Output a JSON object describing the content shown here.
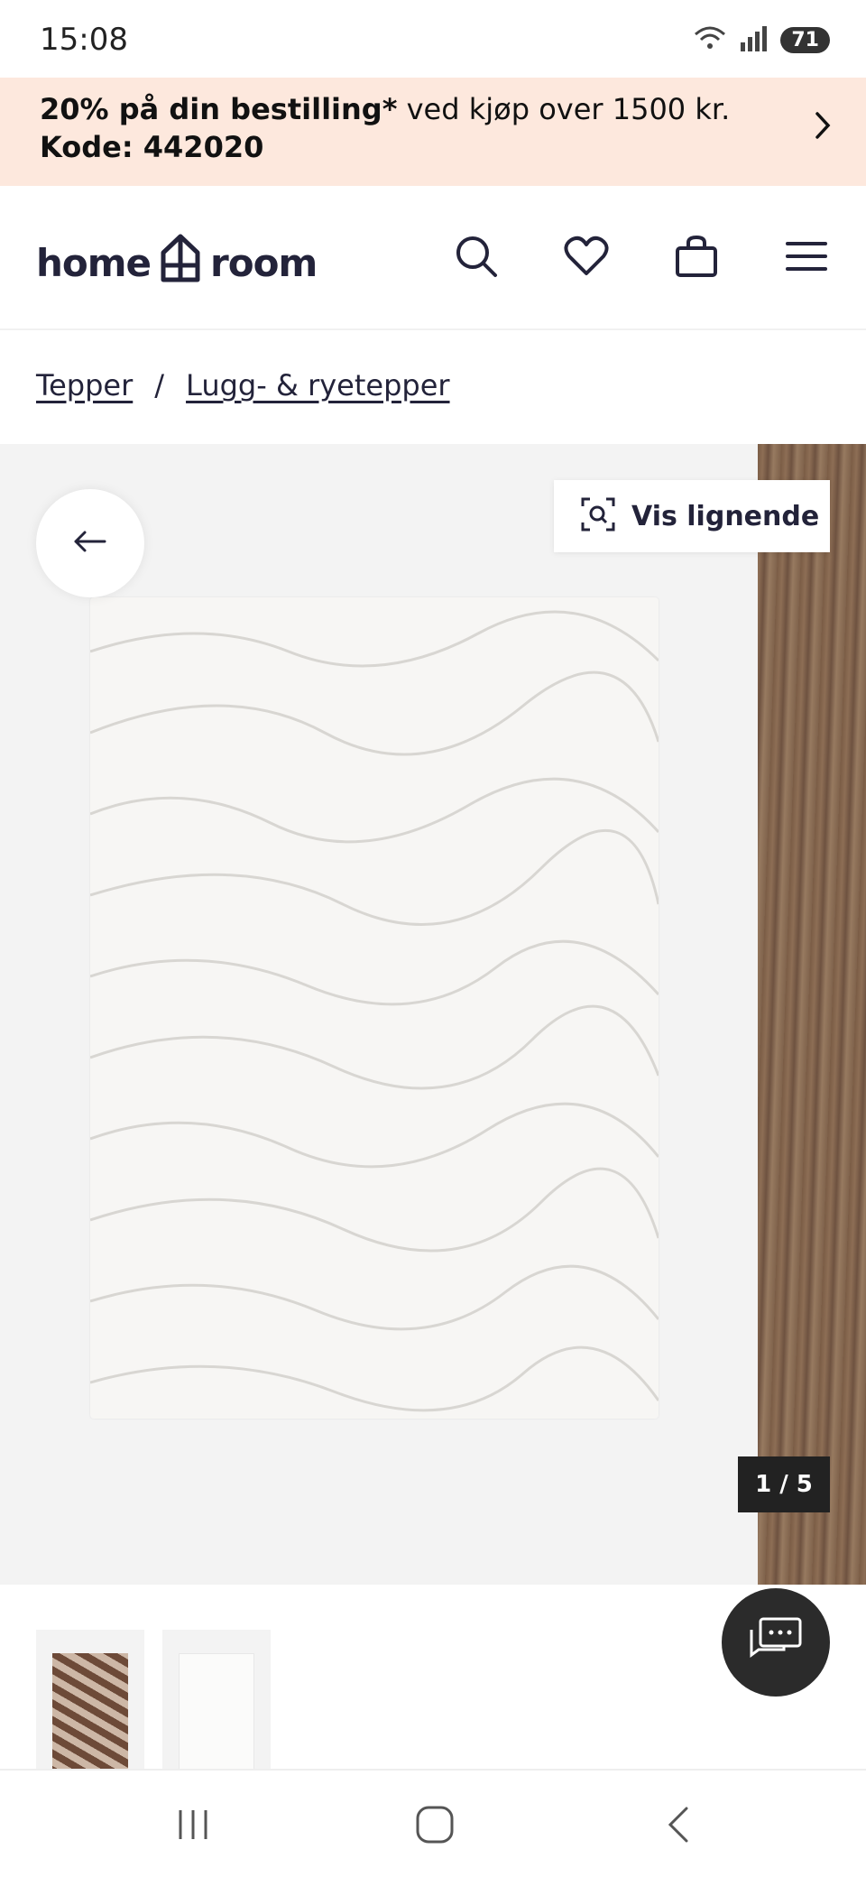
{
  "status_bar": {
    "time": "15:08",
    "battery": "71",
    "icons": [
      "wifi-icon",
      "signal-icon",
      "battery-icon"
    ]
  },
  "promo": {
    "bold_text": "20% på din bestilling*",
    "regular_text": " ved kjøp over 1500 kr.",
    "code_text": "Kode: 442020",
    "background_color": "#fde8dd"
  },
  "header": {
    "logo_left": "home",
    "logo_right": "room",
    "icons": [
      "search-icon",
      "heart-icon",
      "bag-icon",
      "menu-icon"
    ]
  },
  "breadcrumb": {
    "items": [
      "Tepper",
      "Lugg- & ryetepper"
    ],
    "separator": "/"
  },
  "gallery": {
    "vis_lignende_label": "Vis lignende",
    "counter": "1 / 5"
  },
  "nav_bar": {
    "icons": [
      "recent-apps-icon",
      "home-icon",
      "back-icon"
    ]
  }
}
